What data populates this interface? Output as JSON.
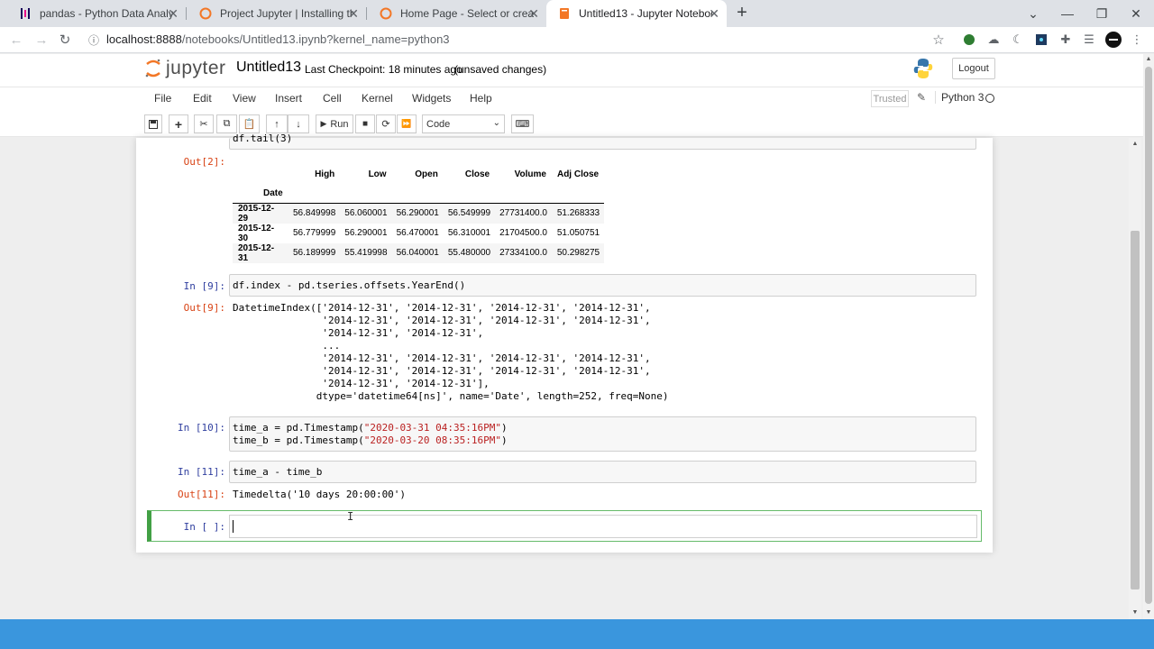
{
  "browser": {
    "tabs": [
      {
        "title": "pandas - Python Data Analysis Li",
        "icon": "pandas-icon"
      },
      {
        "title": "Project Jupyter | Installing the Ju",
        "icon": "jupyter-icon"
      },
      {
        "title": "Home Page - Select or create a n",
        "icon": "jupyter-icon"
      },
      {
        "title": "Untitled13 - Jupyter Notebook",
        "icon": "jupyter-book-icon"
      }
    ],
    "url_host": "localhost:8888",
    "url_path": "/notebooks/Untitled13.ipynb?kernel_name=python3"
  },
  "header": {
    "logo_text": "jupyter",
    "notebook_name": "Untitled13",
    "checkpoint": "Last Checkpoint: 18 minutes ago",
    "unsaved": "(unsaved changes)",
    "logout": "Logout"
  },
  "menu": {
    "items": [
      "File",
      "Edit",
      "View",
      "Insert",
      "Cell",
      "Kernel",
      "Widgets",
      "Help"
    ],
    "trusted": "Trusted",
    "kernel": "Python 3"
  },
  "toolbar": {
    "run_label": "Run",
    "cell_type": "Code"
  },
  "cells": {
    "c2": {
      "in_partial": "df.tail(3)",
      "out_prompt": "Out[2]:",
      "table": {
        "columns": [
          "High",
          "Low",
          "Open",
          "Close",
          "Volume",
          "Adj Close"
        ],
        "index_name": "Date",
        "rows": [
          {
            "date": "2015-12-29",
            "values": [
              "56.849998",
              "56.060001",
              "56.290001",
              "56.549999",
              "27731400.0",
              "51.268333"
            ]
          },
          {
            "date": "2015-12-30",
            "values": [
              "56.779999",
              "56.290001",
              "56.470001",
              "56.310001",
              "21704500.0",
              "51.050751"
            ]
          },
          {
            "date": "2015-12-31",
            "values": [
              "56.189999",
              "55.419998",
              "56.040001",
              "55.480000",
              "27334100.0",
              "50.298275"
            ]
          }
        ]
      }
    },
    "c9": {
      "in_prompt": "In [9]:",
      "code": "df.index - pd.tseries.offsets.YearEnd()",
      "out_prompt": "Out[9]:",
      "output": [
        "DatetimeIndex(['2014-12-31', '2014-12-31', '2014-12-31', '2014-12-31',",
        "               '2014-12-31', '2014-12-31', '2014-12-31', '2014-12-31',",
        "               '2014-12-31', '2014-12-31',",
        "               ...",
        "               '2014-12-31', '2014-12-31', '2014-12-31', '2014-12-31',",
        "               '2014-12-31', '2014-12-31', '2014-12-31', '2014-12-31',",
        "               '2014-12-31', '2014-12-31'],",
        "              dtype='datetime64[ns]', name='Date', length=252, freq=None)"
      ]
    },
    "c10": {
      "in_prompt": "In [10]:",
      "line1_a": "time_a = pd.Timestamp(",
      "line1_s": "\"2020-03-31 04:35:16PM\"",
      "line2_a": "time_b = pd.Timestamp(",
      "line2_s": "\"2020-03-20 08:35:16PM\"",
      "close": ")"
    },
    "c11": {
      "in_prompt": "In [11]:",
      "code": "time_a - time_b",
      "out_prompt": "Out[11]:",
      "output": "Timedelta('10 days 20:00:00')"
    },
    "empty": {
      "in_prompt": "In [ ]:"
    }
  }
}
